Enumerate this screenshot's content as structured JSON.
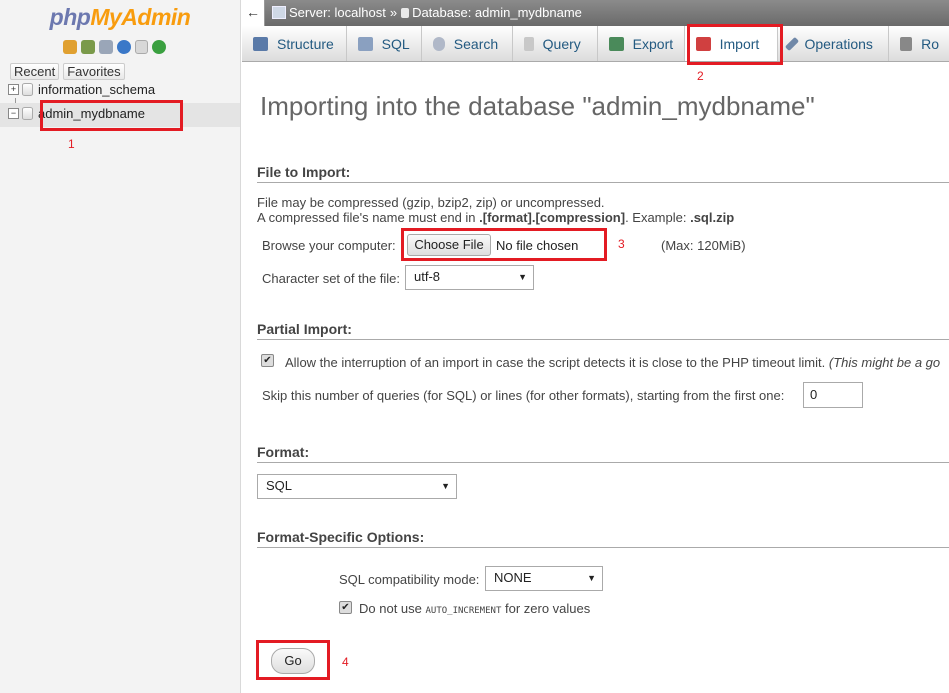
{
  "nav": {
    "logo_php": "php",
    "logo_myadmin": "MyAdmin",
    "icons": [
      "home-icon",
      "exit-icon",
      "sql-icon",
      "help-icon",
      "docs-icon",
      "reload-icon"
    ],
    "tabs": [
      "Recent",
      "Favorites"
    ],
    "databases": [
      "information_schema",
      "admin_mydbname"
    ]
  },
  "topbar": {
    "collapse_symbol": "←",
    "server": "Server: localhost",
    "separator": "»",
    "database": "Database: admin_mydbname"
  },
  "tabs": [
    {
      "label": "Structure",
      "icon": "structure-icon"
    },
    {
      "label": "SQL",
      "icon": "sql-icon"
    },
    {
      "label": "Search",
      "icon": "search-icon"
    },
    {
      "label": "Query",
      "icon": "query-icon"
    },
    {
      "label": "Export",
      "icon": "export-icon"
    },
    {
      "label": "Import",
      "icon": "import-icon"
    },
    {
      "label": "Operations",
      "icon": "wrench-icon"
    },
    {
      "label": "Ro",
      "icon": "routines-icon"
    }
  ],
  "main": {
    "title": "Importing into the database \"admin_mydbname\"",
    "file_section": {
      "heading": "File to Import:",
      "line1": "File may be compressed (gzip, bzip2, zip) or uncompressed.",
      "line2_prefix": "A compressed file's name must end in ",
      "line2_bold1": ".[format].[compression]",
      "line2_mid": ". Example: ",
      "line2_bold2": ".sql.zip",
      "browse_label": "Browse your computer:",
      "choose_button": "Choose File",
      "no_file": "No file chosen",
      "max_size": "(Max: 120MiB)",
      "charset_label": "Character set of the file:",
      "charset_value": "utf-8"
    },
    "partial_section": {
      "heading": "Partial Import:",
      "allow_interrupt_label": "Allow the interruption of an import in case the script detects it is close to the PHP timeout limit.",
      "allow_interrupt_note": "(This might be a go",
      "allow_interrupt_checked": true,
      "skip_label": "Skip this number of queries (for SQL) or lines (for other formats), starting from the first one:",
      "skip_value": "0"
    },
    "format_section": {
      "heading": "Format:",
      "format_value": "SQL"
    },
    "options_section": {
      "heading": "Format-Specific Options:",
      "compat_label": "SQL compatibility mode:",
      "compat_value": "NONE",
      "no_auto_inc_prefix": "Do not use ",
      "no_auto_inc_code": "AUTO_INCREMENT",
      "no_auto_inc_suffix": " for zero values",
      "no_auto_inc_checked": true
    },
    "go_button": "Go"
  },
  "annotations": [
    "1",
    "2",
    "3",
    "4"
  ],
  "colors": {
    "annotation_red": "#e31b23",
    "tab_text": "#235a81",
    "logo_blue": "#6c78af",
    "logo_orange": "#f89c0e"
  }
}
